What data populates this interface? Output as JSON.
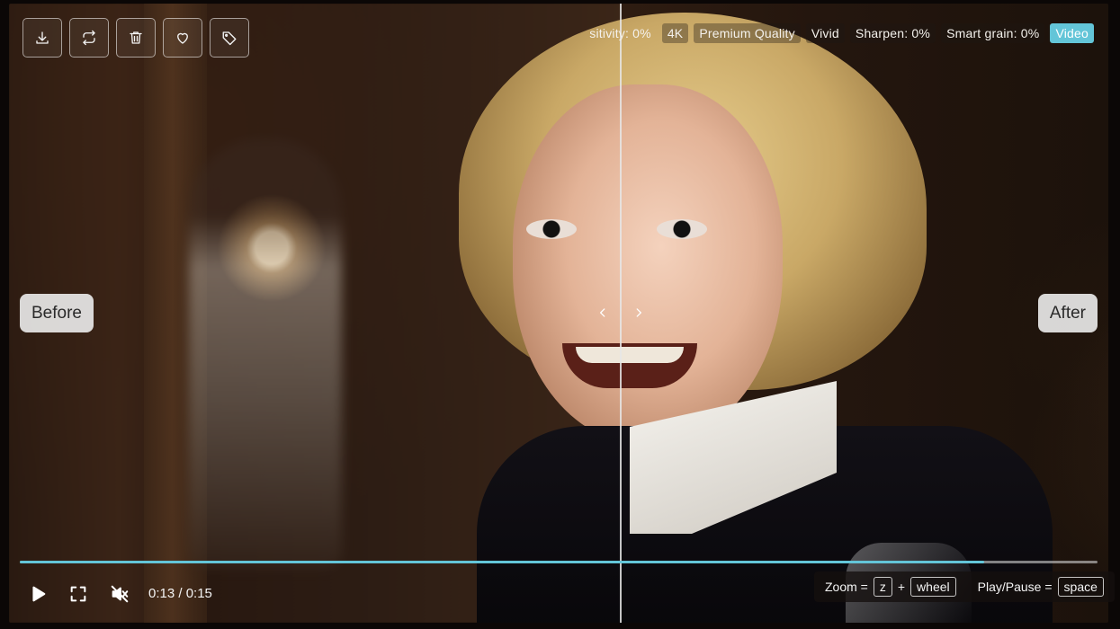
{
  "toolbar": {
    "buttons": [
      {
        "icon": "download-icon"
      },
      {
        "icon": "repeat-icon"
      },
      {
        "icon": "trash-icon"
      },
      {
        "icon": "heart-icon"
      },
      {
        "icon": "tag-icon"
      }
    ]
  },
  "settings_tags": {
    "sensitivity": "sitivity: 0%",
    "resolution": "4K",
    "quality": "Premium Quality",
    "style": "Vivid",
    "sharpen": "Sharpen: 0%",
    "grain": "Smart grain: 0%",
    "type": "Video"
  },
  "compare": {
    "before_label": "Before",
    "after_label": "After"
  },
  "player": {
    "time": "0:13 / 0:15",
    "progress_fraction": 0.895
  },
  "shortcuts": {
    "zoom_label": "Zoom =",
    "zoom_key": "z",
    "plus": "+",
    "zoom_mod": "wheel",
    "play_label": "Play/Pause =",
    "play_key": "space"
  },
  "colors": {
    "accent": "#63c5d8"
  }
}
